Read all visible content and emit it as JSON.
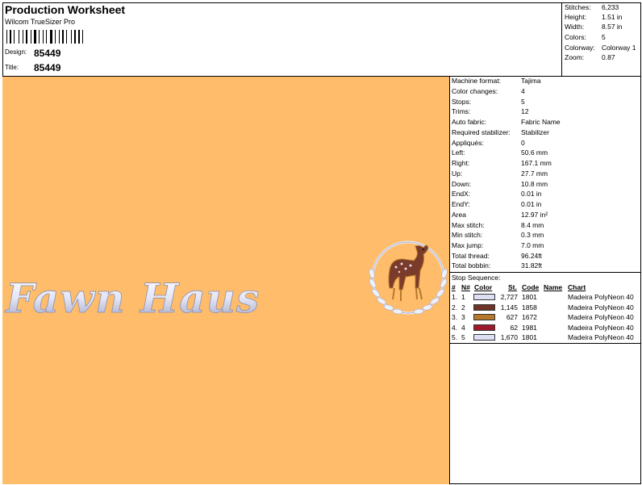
{
  "header": {
    "title": "Production Worksheet",
    "app_name": "Wilcom TrueSizer Pro",
    "design_label": "Design:",
    "design_value": "85449",
    "title_label": "Title:",
    "title_value": "85449"
  },
  "stats": [
    {
      "label": "Stitches:",
      "value": "6,233"
    },
    {
      "label": "Height:",
      "value": "1.51 in"
    },
    {
      "label": "Width:",
      "value": "8.57 in"
    },
    {
      "label": "Colors:",
      "value": "5"
    },
    {
      "label": "Colorway:",
      "value": "Colorway 1"
    },
    {
      "label": "Zoom:",
      "value": "0.87"
    }
  ],
  "design": {
    "text": "Fawn Haus",
    "background_color": "#ffbd6b"
  },
  "info": [
    {
      "label": "Machine format:",
      "value": "Tajima"
    },
    {
      "label": "Color changes:",
      "value": "4"
    },
    {
      "label": "Stops:",
      "value": "5"
    },
    {
      "label": "Trims:",
      "value": "12"
    },
    {
      "label": "Auto fabric:",
      "value": "Fabric Name"
    },
    {
      "label": "Required stabilizer:",
      "value": "Stabilizer"
    },
    {
      "label": "Appliqués:",
      "value": "0"
    },
    {
      "label": "Left:",
      "value": "50.6 mm"
    },
    {
      "label": "Right:",
      "value": "167.1 mm"
    },
    {
      "label": "Up:",
      "value": "27.7 mm"
    },
    {
      "label": "Down:",
      "value": "10.8 mm"
    },
    {
      "label": "EndX:",
      "value": "0.01 in"
    },
    {
      "label": "EndY:",
      "value": "0.01 in"
    },
    {
      "label": "Area",
      "value": " 12.97 in²"
    },
    {
      "label": "Max stitch:",
      "value": "8.4 mm"
    },
    {
      "label": "Min stitch:",
      "value": "0.3 mm"
    },
    {
      "label": "Max jump:",
      "value": "7.0 mm"
    },
    {
      "label": "Total thread:",
      "value": "96.24ft"
    },
    {
      "label": "Total bobbin:",
      "value": "31.82ft"
    }
  ],
  "stop_sequence": {
    "title": "Stop Sequence:",
    "columns": {
      "num": "#",
      "n": "N#",
      "color": "Color",
      "st": "St.",
      "code": "Code",
      "name": "Name",
      "chart": "Chart"
    },
    "rows": [
      {
        "num": "1.",
        "n": "1",
        "color": "#dde0f4",
        "st": "2,727",
        "code": "1801",
        "name": "",
        "chart": "Madeira PolyNeon 40"
      },
      {
        "num": "2.",
        "n": "2",
        "color": "#6e3426",
        "st": "1,145",
        "code": "1858",
        "name": "",
        "chart": "Madeira PolyNeon 40"
      },
      {
        "num": "3.",
        "n": "3",
        "color": "#b5782c",
        "st": "627",
        "code": "1672",
        "name": "",
        "chart": "Madeira PolyNeon 40"
      },
      {
        "num": "4.",
        "n": "4",
        "color": "#9c1a2b",
        "st": "62",
        "code": "1981",
        "name": "",
        "chart": "Madeira PolyNeon 40"
      },
      {
        "num": "5.",
        "n": "5",
        "color": "#dde0f4",
        "st": "1,670",
        "code": "1801",
        "name": "",
        "chart": "Madeira PolyNeon 40"
      }
    ]
  }
}
